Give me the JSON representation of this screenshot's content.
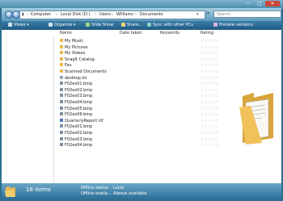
{
  "window": {
    "controls": [
      "─",
      "□",
      "✕"
    ]
  },
  "address": {
    "crumbs": [
      "Computer",
      "Local Disk (D:)",
      "Users",
      "Williams",
      "Documents"
    ],
    "search_placeholder": "Search"
  },
  "toolbar": {
    "items": [
      "Views",
      "Organize",
      "Slide Show",
      "Share...",
      "Sync with other PCs",
      "Preview versions"
    ]
  },
  "columns": {
    "name": "Name",
    "date_taken": "Date taken",
    "keywords": "Keywords",
    "rating": "Rating"
  },
  "files": [
    {
      "name": "My Music",
      "icon": "music-folder-icon"
    },
    {
      "name": "My Pictures",
      "icon": "pictures-folder-icon"
    },
    {
      "name": "My Videos",
      "icon": "videos-folder-icon"
    },
    {
      "name": "SnagIt Catalog",
      "icon": "folder-icon"
    },
    {
      "name": "Fax",
      "icon": "folder-icon"
    },
    {
      "name": "Scanned Documents",
      "icon": "folder-icon"
    },
    {
      "name": "desktop.ini",
      "icon": "settings-file-icon"
    },
    {
      "name": "F02ex01.bmp",
      "icon": "image-file-icon"
    },
    {
      "name": "F02ex02.bmp",
      "icon": "image-file-icon"
    },
    {
      "name": "F02ex03.bmp",
      "icon": "image-file-icon"
    },
    {
      "name": "F02ex04.bmp",
      "icon": "image-file-icon"
    },
    {
      "name": "F02ex05.bmp",
      "icon": "image-file-icon"
    },
    {
      "name": "F02ex06.bmp",
      "icon": "image-file-icon"
    },
    {
      "name": "QuarterlyReport.rtf",
      "icon": "document-file-icon"
    },
    {
      "name": "F02ex01.bmp",
      "icon": "image-file-icon"
    },
    {
      "name": "F02ex02.bmp",
      "icon": "image-file-icon"
    },
    {
      "name": "F02ex03.bmp",
      "icon": "image-file-icon"
    },
    {
      "name": "F02ex04.bmp",
      "icon": "image-file-icon"
    }
  ],
  "rating_stars": "☆☆☆☆☆",
  "status": {
    "count": "18 items",
    "offline_status_label": "Offline status:",
    "offline_status_value": "Local",
    "offline_avail_label": "Offline availa...",
    "offline_avail_value": "Always available"
  },
  "colors": {
    "accent": "#2e6f8f",
    "folder": "#e8b84a"
  }
}
